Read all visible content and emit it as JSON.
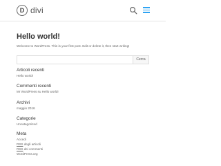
{
  "header": {
    "logo_mark": "D",
    "logo_text": "divi",
    "accent_color": "#2ea3f2"
  },
  "post": {
    "title": "Hello world!",
    "text": "Welcome to WordPress. This is your first post. Edit or delete it, then start writing!"
  },
  "search": {
    "value": "",
    "button_label": "Cerca"
  },
  "widgets": {
    "recent_posts": {
      "title": "Articoli recenti",
      "items": [
        "Hello world!"
      ]
    },
    "recent_comments": {
      "title": "Commenti recenti",
      "author": "Mr WordPress",
      "connector": " su ",
      "post": "Hello world!"
    },
    "archives": {
      "title": "Archivi",
      "items": [
        "maggio 2016"
      ]
    },
    "categories": {
      "title": "Categorie",
      "items": [
        "Uncategorized"
      ]
    },
    "meta": {
      "title": "Meta",
      "login": "Accedi",
      "rss_abbr": "RSS",
      "rss_entries": " degli articoli",
      "rss_comments": " dei commenti",
      "wordpress": "WordPress.org"
    }
  }
}
